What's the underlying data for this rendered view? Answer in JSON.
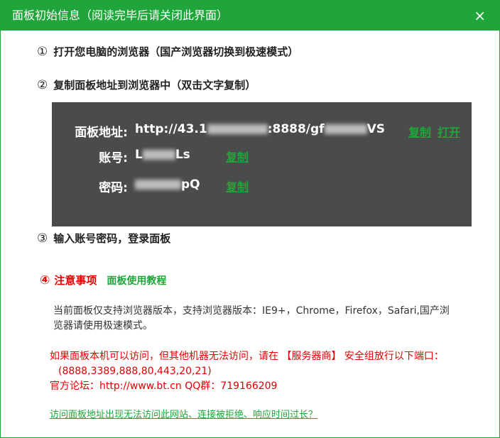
{
  "window": {
    "title": "面板初始信息（阅读完毕后请关闭此界面）",
    "close_glyph": "×"
  },
  "steps": [
    {
      "num": "①",
      "text": "打开您电脑的浏览器（国产浏览器切换到极速模式）"
    },
    {
      "num": "②",
      "text": "复制面板地址到浏览器中（双击文字复制）"
    },
    {
      "num": "③",
      "text": "输入账号密码，登录面板"
    }
  ],
  "panel": {
    "address_label": "面板地址:",
    "address_prefix": "http://43.1",
    "address_middle": ":8888/gf",
    "address_suffix": "VS",
    "account_label": "账号:",
    "account_prefix": "L",
    "account_suffix": "Ls",
    "password_label": "密码:",
    "password_suffix": "pQ",
    "copy_label": "复制",
    "open_label": "打开"
  },
  "notice": {
    "num": "④",
    "label": "注意事项",
    "tutorial_link": "面板使用教程",
    "browser_info": "当前面板仅支持浏览器版本，支持浏览器版本：IE9+，Chrome，Firefox，Safari,国产浏览器请使用极速模式。",
    "port_warning": "如果面板本机可以访问，但其他机器无法访问，请在 【服务器商】 安全组放行以下端口：",
    "ports": "(8888,3389,888,80,443,20,21)",
    "forum": "官方论坛：http://www.bt.cn  QQ群：719166209",
    "trouble_link": "访问面板地址出现无法访问此网站、连接被拒绝、响应时间过长？"
  },
  "colors": {
    "accent": "#20a53a",
    "warning": "#e60000",
    "panel_bg": "#4b4b4b"
  }
}
